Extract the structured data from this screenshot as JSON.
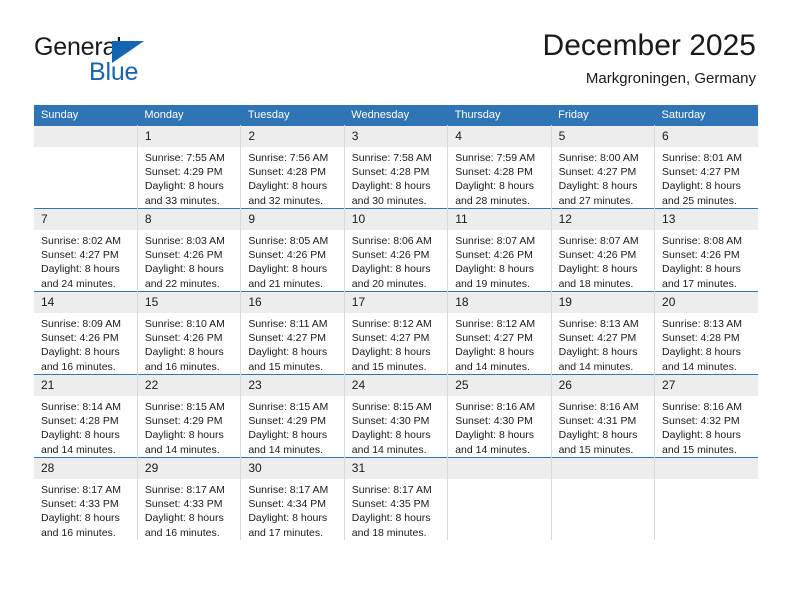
{
  "brand": {
    "name_part1": "General",
    "name_part2": "Blue",
    "accent_color": "#1464b4"
  },
  "header": {
    "title": "December 2025",
    "subtitle": "Markgroningen, Germany"
  },
  "theme": {
    "header_row_color": "#2f75b5",
    "date_strip_color": "#ededed",
    "text_color": "#1a1a1a"
  },
  "weekday_headers": [
    "Sunday",
    "Monday",
    "Tuesday",
    "Wednesday",
    "Thursday",
    "Friday",
    "Saturday"
  ],
  "weeks": [
    [
      {
        "day": "",
        "sunrise": "",
        "sunset": "",
        "daylight_line1": "",
        "daylight_line2": "",
        "empty": true
      },
      {
        "day": "1",
        "sunrise": "Sunrise: 7:55 AM",
        "sunset": "Sunset: 4:29 PM",
        "daylight_line1": "Daylight: 8 hours",
        "daylight_line2": "and 33 minutes."
      },
      {
        "day": "2",
        "sunrise": "Sunrise: 7:56 AM",
        "sunset": "Sunset: 4:28 PM",
        "daylight_line1": "Daylight: 8 hours",
        "daylight_line2": "and 32 minutes."
      },
      {
        "day": "3",
        "sunrise": "Sunrise: 7:58 AM",
        "sunset": "Sunset: 4:28 PM",
        "daylight_line1": "Daylight: 8 hours",
        "daylight_line2": "and 30 minutes."
      },
      {
        "day": "4",
        "sunrise": "Sunrise: 7:59 AM",
        "sunset": "Sunset: 4:28 PM",
        "daylight_line1": "Daylight: 8 hours",
        "daylight_line2": "and 28 minutes."
      },
      {
        "day": "5",
        "sunrise": "Sunrise: 8:00 AM",
        "sunset": "Sunset: 4:27 PM",
        "daylight_line1": "Daylight: 8 hours",
        "daylight_line2": "and 27 minutes."
      },
      {
        "day": "6",
        "sunrise": "Sunrise: 8:01 AM",
        "sunset": "Sunset: 4:27 PM",
        "daylight_line1": "Daylight: 8 hours",
        "daylight_line2": "and 25 minutes."
      }
    ],
    [
      {
        "day": "7",
        "sunrise": "Sunrise: 8:02 AM",
        "sunset": "Sunset: 4:27 PM",
        "daylight_line1": "Daylight: 8 hours",
        "daylight_line2": "and 24 minutes."
      },
      {
        "day": "8",
        "sunrise": "Sunrise: 8:03 AM",
        "sunset": "Sunset: 4:26 PM",
        "daylight_line1": "Daylight: 8 hours",
        "daylight_line2": "and 22 minutes."
      },
      {
        "day": "9",
        "sunrise": "Sunrise: 8:05 AM",
        "sunset": "Sunset: 4:26 PM",
        "daylight_line1": "Daylight: 8 hours",
        "daylight_line2": "and 21 minutes."
      },
      {
        "day": "10",
        "sunrise": "Sunrise: 8:06 AM",
        "sunset": "Sunset: 4:26 PM",
        "daylight_line1": "Daylight: 8 hours",
        "daylight_line2": "and 20 minutes."
      },
      {
        "day": "11",
        "sunrise": "Sunrise: 8:07 AM",
        "sunset": "Sunset: 4:26 PM",
        "daylight_line1": "Daylight: 8 hours",
        "daylight_line2": "and 19 minutes."
      },
      {
        "day": "12",
        "sunrise": "Sunrise: 8:07 AM",
        "sunset": "Sunset: 4:26 PM",
        "daylight_line1": "Daylight: 8 hours",
        "daylight_line2": "and 18 minutes."
      },
      {
        "day": "13",
        "sunrise": "Sunrise: 8:08 AM",
        "sunset": "Sunset: 4:26 PM",
        "daylight_line1": "Daylight: 8 hours",
        "daylight_line2": "and 17 minutes."
      }
    ],
    [
      {
        "day": "14",
        "sunrise": "Sunrise: 8:09 AM",
        "sunset": "Sunset: 4:26 PM",
        "daylight_line1": "Daylight: 8 hours",
        "daylight_line2": "and 16 minutes."
      },
      {
        "day": "15",
        "sunrise": "Sunrise: 8:10 AM",
        "sunset": "Sunset: 4:26 PM",
        "daylight_line1": "Daylight: 8 hours",
        "daylight_line2": "and 16 minutes."
      },
      {
        "day": "16",
        "sunrise": "Sunrise: 8:11 AM",
        "sunset": "Sunset: 4:27 PM",
        "daylight_line1": "Daylight: 8 hours",
        "daylight_line2": "and 15 minutes."
      },
      {
        "day": "17",
        "sunrise": "Sunrise: 8:12 AM",
        "sunset": "Sunset: 4:27 PM",
        "daylight_line1": "Daylight: 8 hours",
        "daylight_line2": "and 15 minutes."
      },
      {
        "day": "18",
        "sunrise": "Sunrise: 8:12 AM",
        "sunset": "Sunset: 4:27 PM",
        "daylight_line1": "Daylight: 8 hours",
        "daylight_line2": "and 14 minutes."
      },
      {
        "day": "19",
        "sunrise": "Sunrise: 8:13 AM",
        "sunset": "Sunset: 4:27 PM",
        "daylight_line1": "Daylight: 8 hours",
        "daylight_line2": "and 14 minutes."
      },
      {
        "day": "20",
        "sunrise": "Sunrise: 8:13 AM",
        "sunset": "Sunset: 4:28 PM",
        "daylight_line1": "Daylight: 8 hours",
        "daylight_line2": "and 14 minutes."
      }
    ],
    [
      {
        "day": "21",
        "sunrise": "Sunrise: 8:14 AM",
        "sunset": "Sunset: 4:28 PM",
        "daylight_line1": "Daylight: 8 hours",
        "daylight_line2": "and 14 minutes."
      },
      {
        "day": "22",
        "sunrise": "Sunrise: 8:15 AM",
        "sunset": "Sunset: 4:29 PM",
        "daylight_line1": "Daylight: 8 hours",
        "daylight_line2": "and 14 minutes."
      },
      {
        "day": "23",
        "sunrise": "Sunrise: 8:15 AM",
        "sunset": "Sunset: 4:29 PM",
        "daylight_line1": "Daylight: 8 hours",
        "daylight_line2": "and 14 minutes."
      },
      {
        "day": "24",
        "sunrise": "Sunrise: 8:15 AM",
        "sunset": "Sunset: 4:30 PM",
        "daylight_line1": "Daylight: 8 hours",
        "daylight_line2": "and 14 minutes."
      },
      {
        "day": "25",
        "sunrise": "Sunrise: 8:16 AM",
        "sunset": "Sunset: 4:30 PM",
        "daylight_line1": "Daylight: 8 hours",
        "daylight_line2": "and 14 minutes."
      },
      {
        "day": "26",
        "sunrise": "Sunrise: 8:16 AM",
        "sunset": "Sunset: 4:31 PM",
        "daylight_line1": "Daylight: 8 hours",
        "daylight_line2": "and 15 minutes."
      },
      {
        "day": "27",
        "sunrise": "Sunrise: 8:16 AM",
        "sunset": "Sunset: 4:32 PM",
        "daylight_line1": "Daylight: 8 hours",
        "daylight_line2": "and 15 minutes."
      }
    ],
    [
      {
        "day": "28",
        "sunrise": "Sunrise: 8:17 AM",
        "sunset": "Sunset: 4:33 PM",
        "daylight_line1": "Daylight: 8 hours",
        "daylight_line2": "and 16 minutes."
      },
      {
        "day": "29",
        "sunrise": "Sunrise: 8:17 AM",
        "sunset": "Sunset: 4:33 PM",
        "daylight_line1": "Daylight: 8 hours",
        "daylight_line2": "and 16 minutes."
      },
      {
        "day": "30",
        "sunrise": "Sunrise: 8:17 AM",
        "sunset": "Sunset: 4:34 PM",
        "daylight_line1": "Daylight: 8 hours",
        "daylight_line2": "and 17 minutes."
      },
      {
        "day": "31",
        "sunrise": "Sunrise: 8:17 AM",
        "sunset": "Sunset: 4:35 PM",
        "daylight_line1": "Daylight: 8 hours",
        "daylight_line2": "and 18 minutes."
      },
      {
        "day": "",
        "sunrise": "",
        "sunset": "",
        "daylight_line1": "",
        "daylight_line2": "",
        "empty": true
      },
      {
        "day": "",
        "sunrise": "",
        "sunset": "",
        "daylight_line1": "",
        "daylight_line2": "",
        "empty": true
      },
      {
        "day": "",
        "sunrise": "",
        "sunset": "",
        "daylight_line1": "",
        "daylight_line2": "",
        "empty": true
      }
    ]
  ]
}
